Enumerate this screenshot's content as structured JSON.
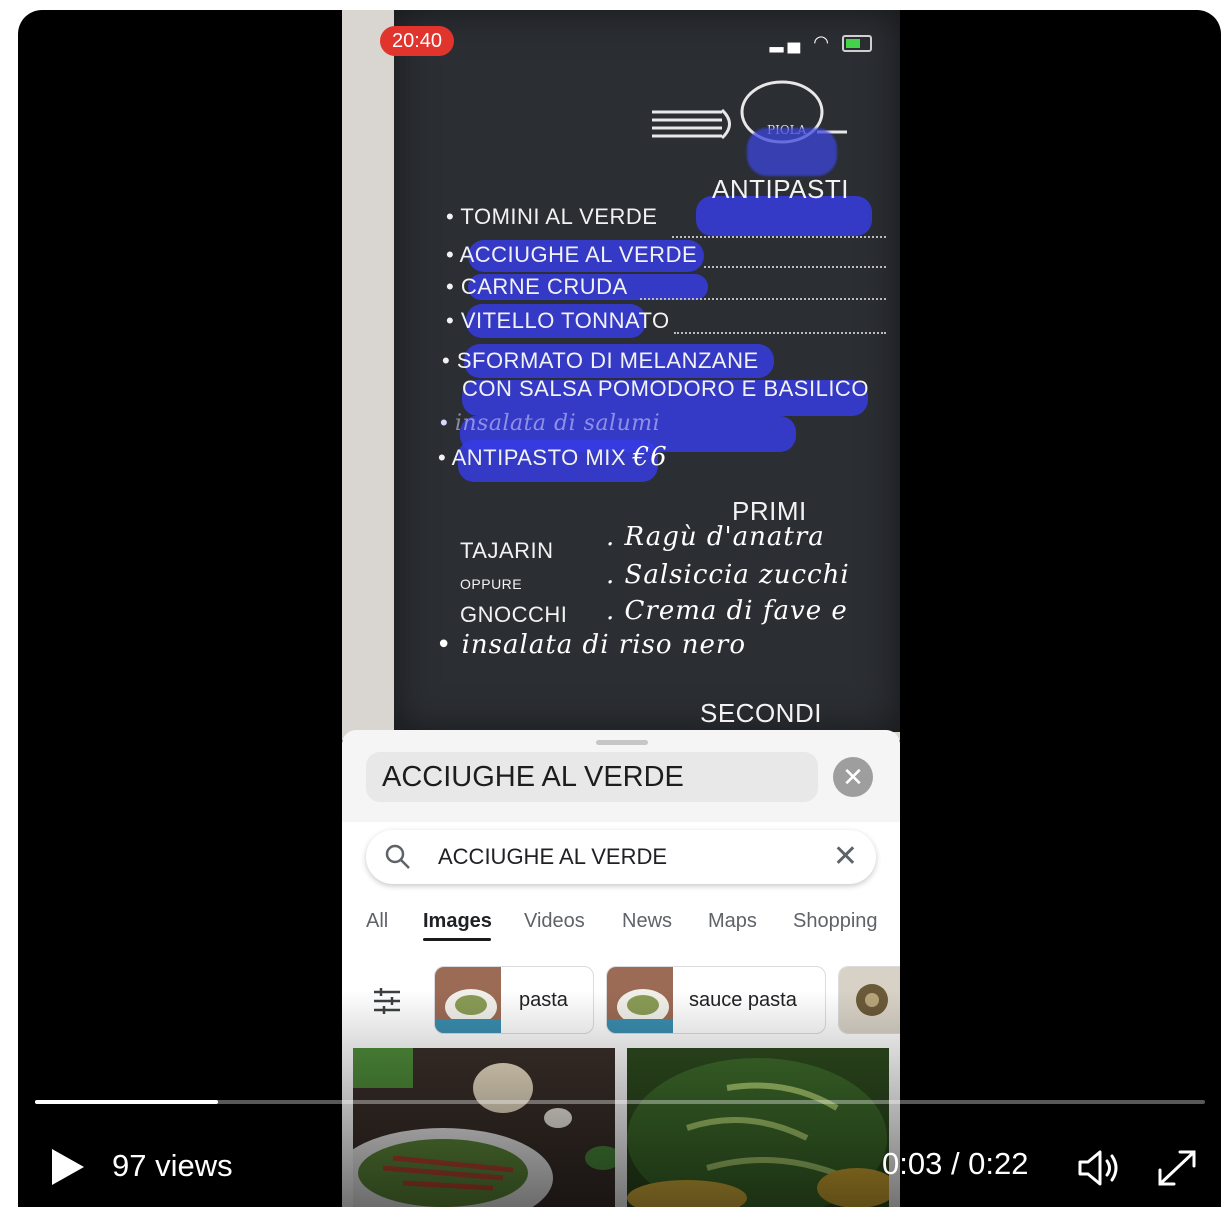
{
  "status": {
    "time": "20:40"
  },
  "menu": {
    "logo_text": "PIOLA",
    "sections": {
      "antipasti": "ANTIPASTI",
      "primi": "PRIMI",
      "secondi": "SECONDI"
    },
    "antipasti_items": [
      "TOMINI AL VERDE",
      "ACCIUGHE AL VERDE",
      "CARNE CRUDA",
      "VITELLO TONNATO",
      "SFORMATO DI MELANZANE",
      "CON SALSA POMODORO E BASILICO",
      "ANTIPASTO MIX"
    ],
    "antipasti_price": "€6",
    "primi_left": [
      "TAJARIN",
      "OPPURE",
      "GNOCCHI"
    ],
    "primi_right": [
      "Ragù d'anatra",
      "Salsiccia zucchi",
      "Crema di fave e"
    ],
    "primi_extra": "insalata di riso nero"
  },
  "lens": {
    "query": "ACCIUGHE AL VERDE"
  },
  "search": {
    "query": "ACCIUGHE AL VERDE",
    "tabs": [
      "All",
      "Images",
      "Videos",
      "News",
      "Maps",
      "Shopping"
    ],
    "active_tab": "Images",
    "chips": [
      "pasta",
      "sauce pasta"
    ]
  },
  "video": {
    "views": "97 views",
    "time": "0:03 / 0:22",
    "progress": 0.156
  },
  "colors": {
    "highlight": "#3a3ee6",
    "status_pill": "#e0342d",
    "chalkboard": "#2b2e33"
  }
}
